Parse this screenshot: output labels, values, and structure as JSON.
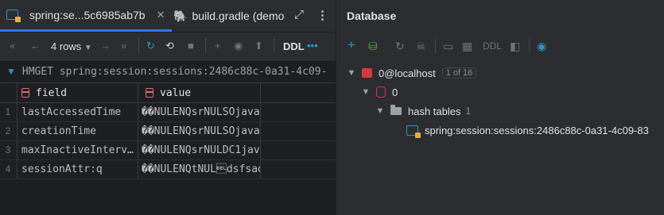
{
  "editor": {
    "tabs": [
      {
        "label": "spring:se...5c6985ab7b",
        "icon": "hash-table-icon",
        "active": true
      },
      {
        "label": "build.gradle (demo",
        "icon": "gradle-elephant-icon",
        "active": false
      }
    ],
    "toolbar": {
      "rows_label": "4 rows",
      "ddl_label": "DDL"
    },
    "filter_text": "HMGET spring:session:sessions:2486c88c-0a31-4c09-",
    "grid": {
      "columns": [
        "field",
        "value"
      ],
      "rows": [
        {
          "num": "1",
          "field": "lastAccessedTime",
          "value": "��NULENQsrNULSOjava"
        },
        {
          "num": "2",
          "field": "creationTime",
          "value": "��NULENQsrNULSOjava"
        },
        {
          "num": "3",
          "field": "maxInactiveInterv…",
          "value": "��NULENQsrNULDC1jav"
        },
        {
          "num": "4",
          "field": "sessionAttr:q",
          "value": "��NULENQtNUL\u0007dsfsad"
        }
      ]
    }
  },
  "database": {
    "title": "Database",
    "toolbar": {
      "ddl_label": "DDL"
    },
    "tree": {
      "connection": {
        "label": "0@localhost",
        "badge": "1 of 16"
      },
      "db": {
        "label": "0"
      },
      "folder": {
        "label": "hash tables",
        "count": "1"
      },
      "item": {
        "label": "spring:session:sessions:2486c88c-0a31-4c09-83"
      }
    }
  },
  "colors": {
    "accent": "#3574f0",
    "redis": "#d63b3b",
    "editor_bg": "#1e1f22",
    "panel_bg": "#2b2d30"
  }
}
